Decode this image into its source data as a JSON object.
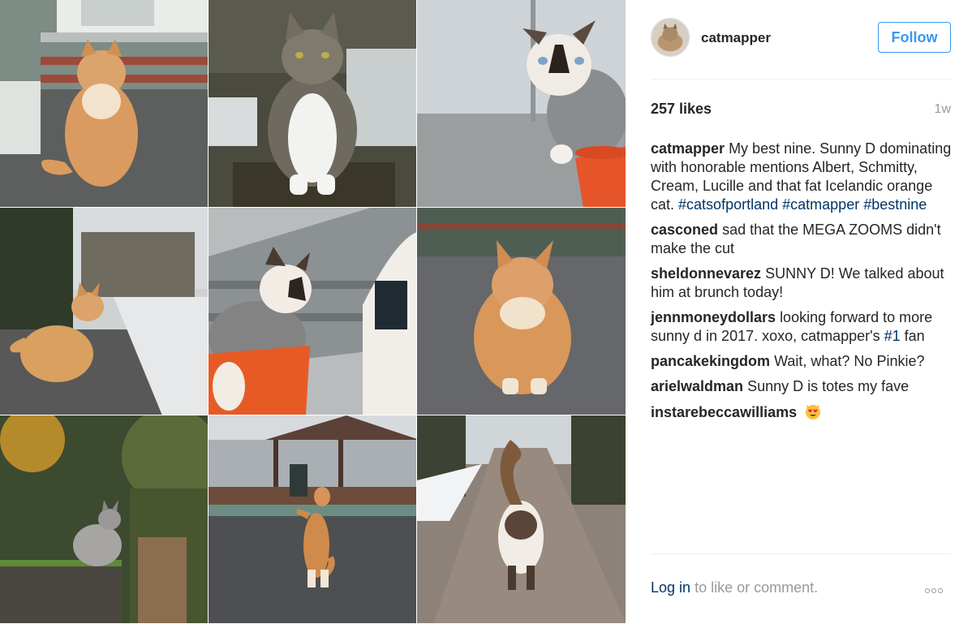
{
  "post": {
    "username": "catmapper",
    "follow_label": "Follow",
    "likes": "257 likes",
    "time": "1w",
    "caption": {
      "user": "catmapper",
      "text": "My best nine. Sunny D dominating with honorable mentions Albert, Schmitty, Cream, Lucille and that fat Icelandic orange cat.",
      "tags": [
        "#catsofportland",
        "#catmapper",
        "#bestnine"
      ]
    },
    "comments": [
      {
        "user": "casconed",
        "text": "sad that the MEGA ZOOMS didn't make the cut"
      },
      {
        "user": "sheldonnevarez",
        "text": "SUNNY D! We talked about him at brunch today!"
      },
      {
        "user": "jennmoneydollars",
        "text_before": "looking forward to more sunny d in 2017. xoxo, catmapper's",
        "tag": "#1",
        "text_after": "fan"
      },
      {
        "user": "pancakekingdom",
        "text": "Wait, what? No Pinkie?"
      },
      {
        "user": "arielwaldman",
        "text": "Sunny D is totes my fave"
      },
      {
        "user": "instarebeccawilliams",
        "emoji": "heart-eyes-cat-emoji"
      }
    ],
    "footer": {
      "login_label": "Log in",
      "rest": "to like or comment."
    }
  },
  "photos": [
    {
      "name": "orange-longhair-cat-porch"
    },
    {
      "name": "tabby-white-cat-snow"
    },
    {
      "name": "siamese-cat-sweater-bucket"
    },
    {
      "name": "orange-cat-snowy-sidewalk"
    },
    {
      "name": "siamese-cat-bucket-train"
    },
    {
      "name": "orange-cat-sitting-street"
    },
    {
      "name": "grey-fluffy-cat-wall"
    },
    {
      "name": "orange-cat-standing-park"
    },
    {
      "name": "siamese-cat-walking-sidewalk"
    }
  ],
  "colors": {
    "accent": "#3897f0",
    "tag": "#003569",
    "muted": "#999999"
  }
}
